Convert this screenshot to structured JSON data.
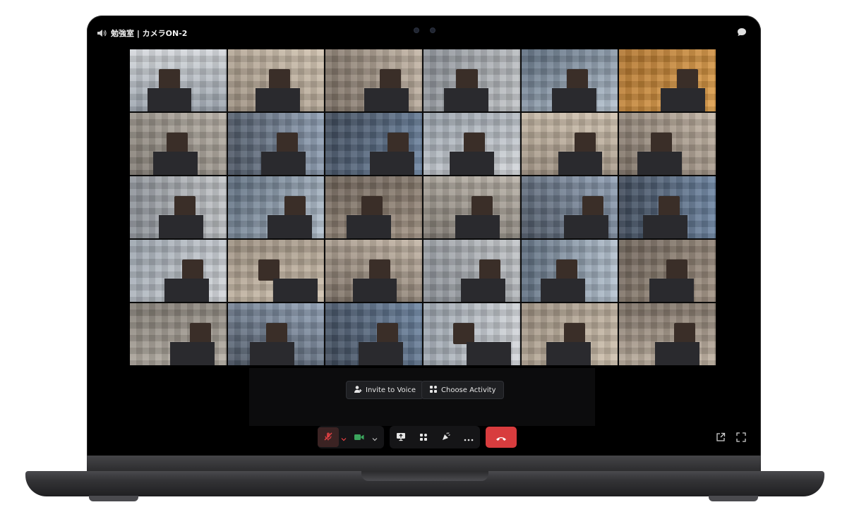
{
  "window": {
    "channel_title": "勉強室 | カメラON-2",
    "speaker_icon": "speaker-icon",
    "chat_icon": "chat-bubble-icon"
  },
  "activity": {
    "invite_label": "Invite to Voice",
    "invite_icon": "add-person-icon",
    "activity_label": "Choose Activity",
    "activity_icon": "activity-grid-icon"
  },
  "controls": {
    "mic_icon": "microphone-muted-icon",
    "camera_icon": "camera-icon",
    "screen_share_icon": "screen-share-icon",
    "apps_icon": "apps-icon",
    "soundboard_icon": "soundboard-icon",
    "more_icon": "more-options-icon",
    "leave_icon": "hang-up-icon",
    "popout_icon": "pop-out-icon",
    "fullscreen_icon": "fullscreen-icon"
  },
  "colors": {
    "leave_red": "#d83c3e",
    "camera_green": "#3ba55d",
    "muted_red": "#ed4245"
  }
}
